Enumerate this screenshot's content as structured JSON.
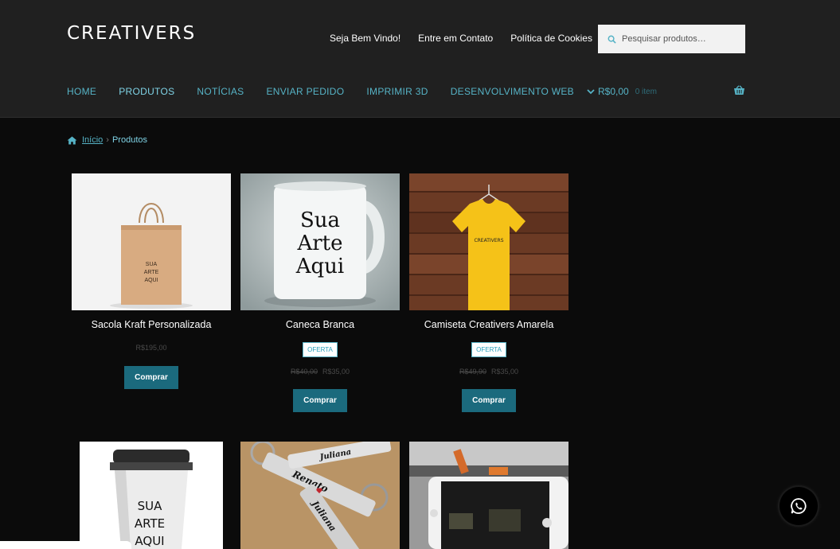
{
  "brand": {
    "logo_text": "CREATIVERS"
  },
  "top_links": [
    "Seja Bem Vindo!",
    "Entre em Contato",
    "Política de Cookies"
  ],
  "search": {
    "placeholder": "Pesquisar produtos…"
  },
  "nav": {
    "items": [
      "HOME",
      "PRODUTOS",
      "NOTÍCIAS",
      "ENVIAR PEDIDO",
      "IMPRIMIR 3D",
      "DESENVOLVIMENTO WEB"
    ],
    "active": "PRODUTOS"
  },
  "cart": {
    "total": "R$0,00",
    "count": "0 item"
  },
  "breadcrumb": {
    "home": "Início",
    "current": "Produtos"
  },
  "products": [
    {
      "title": "Sacola Kraft Personalizada",
      "price": "R$195,00",
      "button": "Comprar",
      "image_text": "SUA ARTE AQUI"
    },
    {
      "title": "Caneca Branca",
      "badge": "OFERTA",
      "old_price": "R$40,00",
      "price": "R$35,00",
      "button": "Comprar",
      "image_text": "Sua Arte Aqui"
    },
    {
      "title": "Camiseta Creativers Amarela",
      "badge": "OFERTA",
      "old_price": "R$49,90",
      "price": "R$35,00",
      "button": "Comprar",
      "image_text": "CREATIVERS"
    },
    {
      "image_text": "SUA ARTE AQUI"
    },
    {
      "image_text": "Renato Juliana"
    },
    {
      "image_text": ""
    }
  ],
  "colors": {
    "accent": "#56b3c6",
    "button": "#1b6a7d",
    "header_bg": "#202020",
    "page_bg": "#0b0b0b"
  }
}
